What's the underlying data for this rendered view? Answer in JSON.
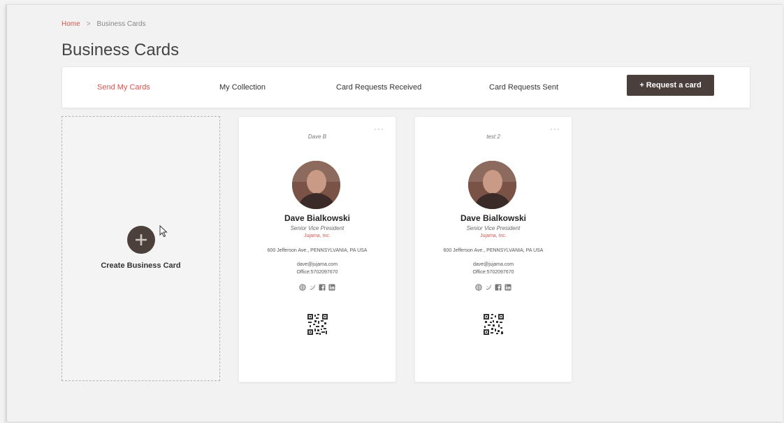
{
  "breadcrumb": {
    "home": "Home",
    "separator": ">",
    "current": "Business Cards"
  },
  "page_title": "Business Cards",
  "tabs": [
    {
      "label": "Send My Cards",
      "active": true
    },
    {
      "label": "My Collection",
      "active": false
    },
    {
      "label": "Card Requests Received",
      "active": false
    },
    {
      "label": "Card Requests Sent",
      "active": false
    }
  ],
  "request_button": "+ Request a card",
  "create_card": {
    "icon": "plus-icon",
    "label": "Create Business Card"
  },
  "cards": [
    {
      "nickname": "Dave B",
      "menu": "···",
      "name": "Dave Bialkowski",
      "title": "Senior Vice President",
      "company": "Jujama, Inc.",
      "address": "600 Jefferson Ave., PENNSYLVANIA, PA USA",
      "email": "dave@jujama.com",
      "office": "Office:5702097670",
      "social_icons": [
        "globe-icon",
        "twitter-icon",
        "facebook-icon",
        "linkedin-icon"
      ]
    },
    {
      "nickname": "test 2",
      "menu": "···",
      "name": "Dave Bialkowski",
      "title": "Senior Vice President",
      "company": "Jujama, Inc.",
      "address": "600 Jefferson Ave., PENNSYLVANIA, PA USA",
      "email": "dave@jujama.com",
      "office": "Office:5702097670",
      "social_icons": [
        "globe-icon",
        "twitter-icon",
        "facebook-icon",
        "linkedin-icon"
      ]
    }
  ],
  "colors": {
    "accent": "#d9534f",
    "button": "#4a3f3b",
    "background": "#f2f2f2"
  }
}
